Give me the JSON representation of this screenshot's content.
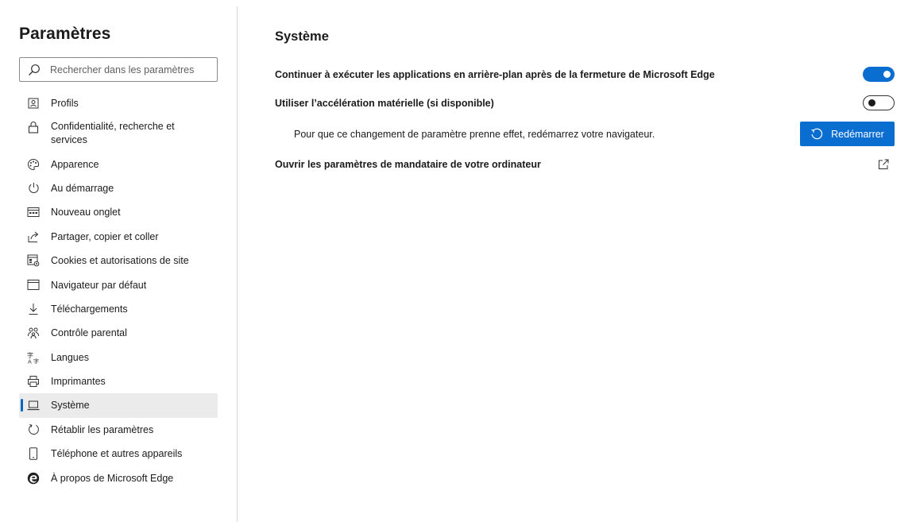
{
  "sidebar": {
    "title": "Paramètres",
    "search_placeholder": "Rechercher dans les paramètres",
    "items": [
      {
        "label": "Profils",
        "icon": "profile-icon"
      },
      {
        "label": "Confidentialité, recherche et services",
        "icon": "lock-icon"
      },
      {
        "label": "Apparence",
        "icon": "palette-icon"
      },
      {
        "label": "Au démarrage",
        "icon": "power-icon"
      },
      {
        "label": "Nouveau onglet",
        "icon": "new-tab-icon"
      },
      {
        "label": "Partager, copier et coller",
        "icon": "share-icon"
      },
      {
        "label": "Cookies et autorisations de site",
        "icon": "cookies-icon"
      },
      {
        "label": "Navigateur par défaut",
        "icon": "browser-icon"
      },
      {
        "label": "Téléchargements",
        "icon": "download-icon"
      },
      {
        "label": "Contrôle parental",
        "icon": "family-icon"
      },
      {
        "label": "Langues",
        "icon": "language-icon"
      },
      {
        "label": "Imprimantes",
        "icon": "printer-icon"
      },
      {
        "label": "Système",
        "icon": "laptop-icon",
        "active": true
      },
      {
        "label": "Rétablir les paramètres",
        "icon": "reset-icon"
      },
      {
        "label": "Téléphone et autres appareils",
        "icon": "phone-icon"
      },
      {
        "label": "À propos de Microsoft Edge",
        "icon": "edge-logo-icon"
      }
    ]
  },
  "main": {
    "title": "Système",
    "background_apps": {
      "label": "Continuer à exécuter les applications en arrière-plan après de la fermeture de Microsoft Edge",
      "enabled": true
    },
    "hardware_accel": {
      "label": "Utiliser l’accélération matérielle (si disponible)",
      "enabled": false
    },
    "restart_notice": {
      "text": "Pour que ce changement de paramètre prenne effet, redémarrez votre navigateur.",
      "button_label": "Redémarrer"
    },
    "proxy": {
      "label": "Ouvrir les paramètres de mandataire de votre ordinateur"
    }
  },
  "colors": {
    "accent": "#0a6ed1",
    "active_item_bg": "#ebebeb",
    "active_indicator": "#0067c0"
  }
}
